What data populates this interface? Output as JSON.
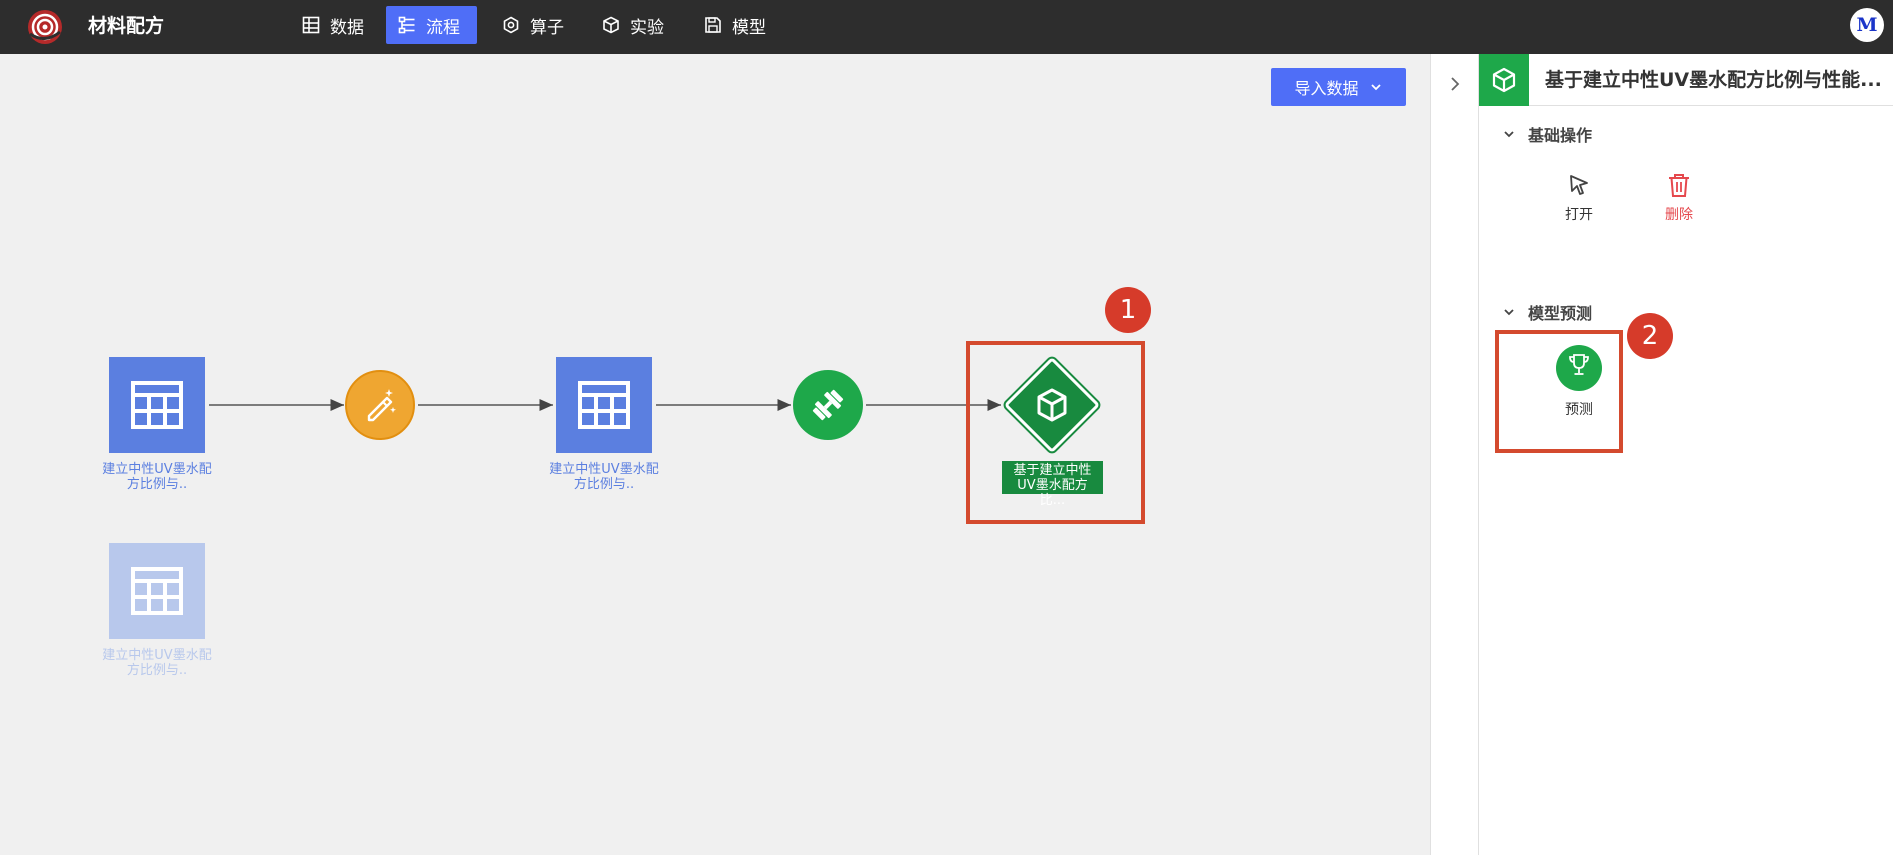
{
  "app": {
    "title": "材料配方"
  },
  "nav": {
    "items": [
      {
        "label": "数据",
        "icon": "table-icon"
      },
      {
        "label": "流程",
        "icon": "flow-icon",
        "active": true
      },
      {
        "label": "算子",
        "icon": "operator-icon"
      },
      {
        "label": "实验",
        "icon": "cube-icon"
      },
      {
        "label": "模型",
        "icon": "save-icon"
      }
    ]
  },
  "user": {
    "avatar_initial": "M"
  },
  "canvas": {
    "import_button": "导入数据",
    "nodes": {
      "dataset1_label": "建立中性UV墨水配方比例与..",
      "dataset2_label": "建立中性UV墨水配方比例与..",
      "dataset3_label": "建立中性UV墨水配方比例与..",
      "model_label": "基于建立中性UV墨水配方比..."
    },
    "badges": {
      "first": "1",
      "second": "2"
    }
  },
  "panel": {
    "title": "基于建立中性UV墨水配方比例与性能...",
    "basic_section": "基础操作",
    "open_label": "打开",
    "delete_label": "删除",
    "predict_section": "模型预测",
    "predict_label": "预测"
  },
  "colors": {
    "accent": "#4f6ef7",
    "dataset": "#5b7fe0",
    "model": "#188a3f",
    "operator_orange": "#efa631",
    "train_green": "#1ea84a",
    "highlight": "#d44a2e",
    "delete": "#e5484d"
  }
}
